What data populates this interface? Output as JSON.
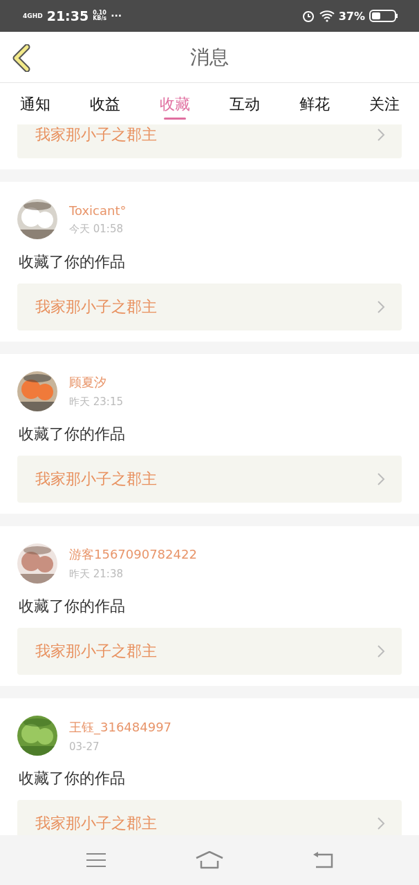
{
  "status_bar": {
    "network": "4GHD",
    "time": "21:35",
    "speed": "0.10",
    "speed_unit": "KB/s",
    "more": "···",
    "battery": "37%"
  },
  "header": {
    "title": "消息"
  },
  "tabs": [
    {
      "label": "通知",
      "selected": false
    },
    {
      "label": "收益",
      "selected": false
    },
    {
      "label": "收藏",
      "selected": true
    },
    {
      "label": "互动",
      "selected": false
    },
    {
      "label": "鲜花",
      "selected": false
    },
    {
      "label": "关注",
      "selected": false
    }
  ],
  "partial_card": {
    "work": "我家那小子之郡主"
  },
  "cards": [
    {
      "name": "Toxicant°",
      "time": "今天 01:58",
      "action": "收藏了你的作品",
      "work": "我家那小子之郡主"
    },
    {
      "name": "顾夏汐",
      "time": "昨天 23:15",
      "action": "收藏了你的作品",
      "work": "我家那小子之郡主"
    },
    {
      "name": "游客1567090782422",
      "time": "昨天 21:38",
      "action": "收藏了你的作品",
      "work": "我家那小子之郡主"
    },
    {
      "name": "王钰_316484997",
      "time": "03-27",
      "action": "收藏了你的作品",
      "work": "我家那小子之郡主"
    }
  ]
}
